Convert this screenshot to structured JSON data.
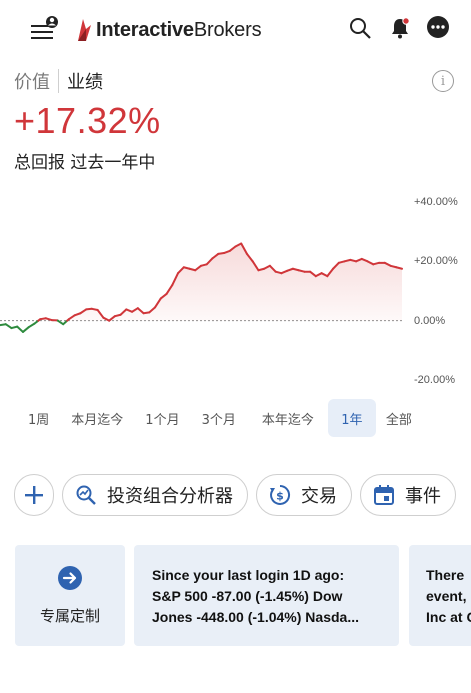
{
  "header": {
    "logo_bold": "Interactive",
    "logo_regular": "Brokers",
    "icons": [
      "menu-icon",
      "account-badge-icon",
      "search-icon",
      "bell-icon",
      "more-icon"
    ]
  },
  "tabs": [
    {
      "label": "价值",
      "active": false
    },
    {
      "label": "业绩",
      "active": true
    }
  ],
  "performance": {
    "value": "+17.32%",
    "caption": "总回报 过去一年中"
  },
  "chart_data": {
    "type": "line",
    "ylim": [
      -20,
      40
    ],
    "yticks": [
      "+40.00%",
      "+20.00%",
      "0.00%",
      "-20.00%"
    ],
    "colors": {
      "positive": "#d0363a",
      "negative": "#2e8b3e",
      "fill": "#f6d6d6",
      "baseline": "#888888"
    },
    "x": [
      0,
      1,
      2,
      3,
      4,
      5,
      6,
      7,
      8,
      9,
      10,
      11,
      12,
      13,
      14,
      15,
      16,
      17,
      18,
      19,
      20,
      21,
      22,
      23,
      24,
      25,
      26,
      27,
      28,
      29,
      30,
      31,
      32,
      33,
      34,
      35,
      36,
      37,
      38,
      39,
      40,
      41,
      42,
      43,
      44,
      45,
      46,
      47,
      48,
      49,
      50,
      51,
      52,
      53,
      54,
      55,
      56,
      57,
      58,
      59,
      60,
      61,
      62,
      63,
      64,
      65,
      66,
      67,
      68,
      69,
      70
    ],
    "values": [
      -1.5,
      -1.2,
      -2.5,
      -2.0,
      -3.8,
      -2.2,
      -1.0,
      0.5,
      0.8,
      0.2,
      0.1,
      -1.2,
      0.5,
      1.8,
      2.5,
      3.8,
      4.0,
      3.6,
      1.0,
      0.0,
      1.5,
      2.0,
      3.8,
      3.0,
      4.2,
      2.5,
      2.8,
      4.5,
      7.5,
      9.0,
      12.0,
      16.0,
      18.0,
      17.5,
      17.0,
      18.5,
      19.0,
      21.0,
      22.5,
      22.8,
      23.5,
      25.0,
      26.0,
      22.5,
      20.0,
      17.0,
      17.5,
      18.5,
      16.5,
      16.0,
      16.8,
      17.5,
      17.0,
      16.5,
      16.5,
      15.0,
      16.0,
      15.0,
      17.5,
      19.5,
      20.0,
      20.5,
      20.0,
      20.8,
      20.0,
      19.0,
      19.5,
      19.5,
      18.5,
      18.0,
      17.5
    ]
  },
  "periods": [
    {
      "label": "1周",
      "active": false
    },
    {
      "label": "本月迄今",
      "active": false
    },
    {
      "label": "1个月",
      "active": false
    },
    {
      "label": "3个月",
      "active": false
    },
    {
      "label": "本年迄今",
      "active": false
    },
    {
      "label": "1年",
      "active": true
    },
    {
      "label": "全部",
      "active": false
    }
  ],
  "actions": [
    {
      "label": "",
      "icon": "plus-icon"
    },
    {
      "label": "投资组合分析器",
      "icon": "portfolio-analyzer-icon"
    },
    {
      "label": "交易",
      "icon": "trade-icon"
    },
    {
      "label": "事件",
      "icon": "calendar-icon"
    }
  ],
  "cards": [
    {
      "label": "专属定制",
      "icon": "arrow-right-circle-icon"
    },
    {
      "lines": [
        "Since your last login 1D ago:",
        "S&P 500 -87.00 (-1.45%) Dow",
        "Jones -448.00 (-1.04%) Nasda..."
      ]
    },
    {
      "lines": [
        "There",
        "event,",
        "Inc at C"
      ]
    }
  ]
}
